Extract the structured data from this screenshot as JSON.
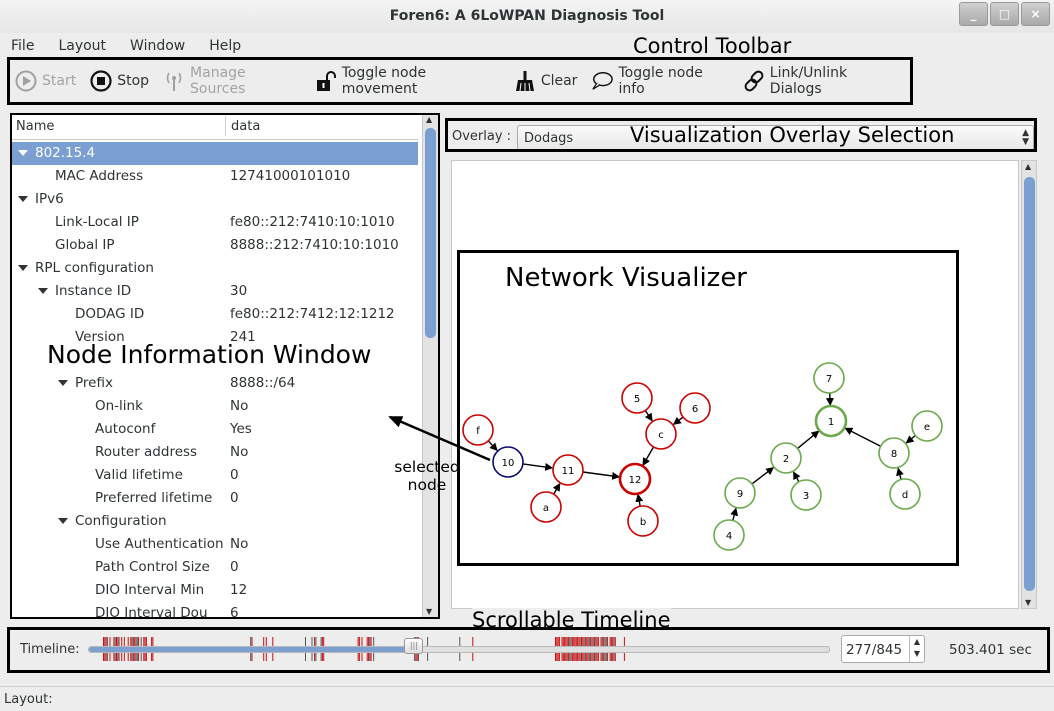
{
  "window": {
    "title": "Foren6: A 6LoWPAN Diagnosis Tool",
    "buttons": [
      "_",
      "□",
      "×"
    ]
  },
  "menu": [
    "File",
    "Layout",
    "Window",
    "Help"
  ],
  "toolbar": {
    "start": "Start",
    "stop": "Stop",
    "manage_sources": "Manage Sources",
    "toggle_node_movement": "Toggle node movement",
    "clear": "Clear",
    "toggle_node_info": "Toggle node info",
    "link_unlink": "Link/Unlink Dialogs"
  },
  "annotations": {
    "control_toolbar": "Control Toolbar",
    "overlay_selection": "Visualization Overlay Selection",
    "network_visualizer": "Network Visualizer",
    "node_info_window": "Node Information Window",
    "selected_node": "selected node",
    "scrollable_timeline": "Scrollable Timeline"
  },
  "tree": {
    "col_name": "Name",
    "col_data": "data",
    "rows": [
      {
        "name": "802.15.4",
        "value": "",
        "level": 0,
        "expander": true,
        "selected": true
      },
      {
        "name": "MAC Address",
        "value": "12741000101010",
        "level": 2
      },
      {
        "name": "IPv6",
        "value": "",
        "level": 0,
        "expander": true
      },
      {
        "name": "Link-Local IP",
        "value": "fe80::212:7410:10:1010",
        "level": 2
      },
      {
        "name": "Global IP",
        "value": "8888::212:7410:10:1010",
        "level": 2
      },
      {
        "name": "RPL configuration",
        "value": "",
        "level": 0,
        "expander": true
      },
      {
        "name": "Instance ID",
        "value": "30",
        "level": 1,
        "expander": true
      },
      {
        "name": "DODAG ID",
        "value": "fe80::212:7412:12:1212",
        "level": 3
      },
      {
        "name": "Version",
        "value": "241",
        "level": 3
      },
      {
        "name": "",
        "value": "",
        "level": 3
      },
      {
        "name": "Prefix",
        "value": "8888::/64",
        "level": 2,
        "expander": true
      },
      {
        "name": "On-link",
        "value": "No",
        "level": 4
      },
      {
        "name": "Autoconf",
        "value": "Yes",
        "level": 4
      },
      {
        "name": "Router address",
        "value": "No",
        "level": 4
      },
      {
        "name": "Valid lifetime",
        "value": "0",
        "level": 4
      },
      {
        "name": "Preferred lifetime",
        "value": "0",
        "level": 4
      },
      {
        "name": "Configuration",
        "value": "",
        "level": 2,
        "expander": true
      },
      {
        "name": "Use Authentication",
        "value": "No",
        "level": 4
      },
      {
        "name": "Path Control Size",
        "value": "0",
        "level": 4
      },
      {
        "name": "DIO Interval Min",
        "value": "12",
        "level": 4
      },
      {
        "name": "DIO Interval Dou",
        "value": "6",
        "level": 4
      }
    ]
  },
  "overlay": {
    "label": "Overlay :",
    "value": "Dodags"
  },
  "graph": {
    "nodes": [
      {
        "id": "f",
        "color": "#cc0000",
        "bold": false
      },
      {
        "id": "10",
        "color": "#0a0a6e",
        "bold": false
      },
      {
        "id": "11",
        "color": "#cc0000",
        "bold": false
      },
      {
        "id": "a",
        "color": "#cc0000",
        "bold": false
      },
      {
        "id": "12",
        "color": "#cc0000",
        "bold": true
      },
      {
        "id": "b",
        "color": "#cc0000",
        "bold": false
      },
      {
        "id": "c",
        "color": "#cc0000",
        "bold": false
      },
      {
        "id": "5",
        "color": "#cc0000",
        "bold": false
      },
      {
        "id": "6",
        "color": "#cc0000",
        "bold": false
      },
      {
        "id": "7",
        "color": "#6aaa4a",
        "bold": false
      },
      {
        "id": "1",
        "color": "#6aaa4a",
        "bold": true
      },
      {
        "id": "e",
        "color": "#6aaa4a",
        "bold": false
      },
      {
        "id": "8",
        "color": "#6aaa4a",
        "bold": false
      },
      {
        "id": "d",
        "color": "#6aaa4a",
        "bold": false
      },
      {
        "id": "2",
        "color": "#6aaa4a",
        "bold": false
      },
      {
        "id": "3",
        "color": "#6aaa4a",
        "bold": false
      },
      {
        "id": "9",
        "color": "#6aaa4a",
        "bold": false
      },
      {
        "id": "4",
        "color": "#6aaa4a",
        "bold": false
      }
    ],
    "edges": [
      [
        "f",
        "10"
      ],
      [
        "10",
        "11"
      ],
      [
        "a",
        "11"
      ],
      [
        "11",
        "12"
      ],
      [
        "b",
        "12"
      ],
      [
        "c",
        "12"
      ],
      [
        "5",
        "c"
      ],
      [
        "6",
        "c"
      ],
      [
        "7",
        "1"
      ],
      [
        "2",
        "1"
      ],
      [
        "8",
        "1"
      ],
      [
        "e",
        "8"
      ],
      [
        "d",
        "8"
      ],
      [
        "9",
        "2"
      ],
      [
        "3",
        "2"
      ],
      [
        "4",
        "9"
      ]
    ]
  },
  "timeline": {
    "label": "Timeline:",
    "position": "277/845",
    "time": "503.401 sec",
    "progress": 0.44
  },
  "status": {
    "text": "Layout:"
  }
}
